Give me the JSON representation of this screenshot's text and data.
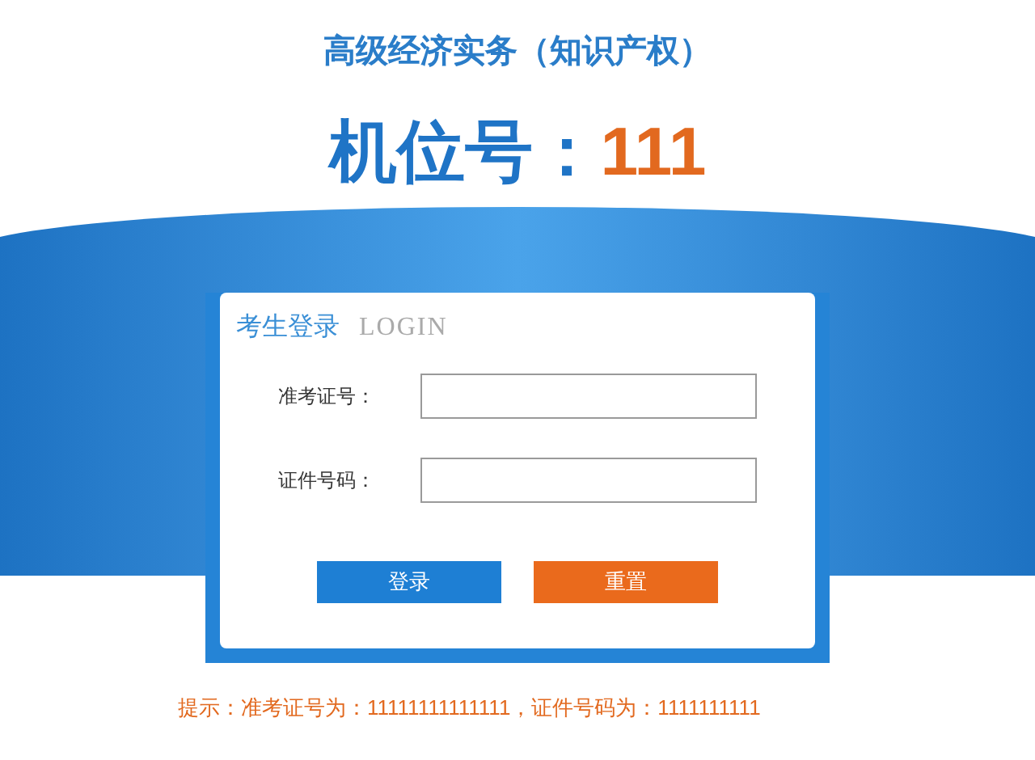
{
  "exam_title": "高级经济实务（知识产权）",
  "seat": {
    "label": "机位号：",
    "number": "111"
  },
  "login_card": {
    "title": "考生登录",
    "subtitle": "LOGIN",
    "fields": [
      {
        "label": "准考证号："
      },
      {
        "label": "证件号码："
      }
    ],
    "buttons": [
      {
        "kind": "primary",
        "label": "登录"
      },
      {
        "kind": "reset",
        "label": "重置"
      }
    ]
  },
  "hint": "提示：准考证号为：11111111111111，证件号码为：1111111111"
}
